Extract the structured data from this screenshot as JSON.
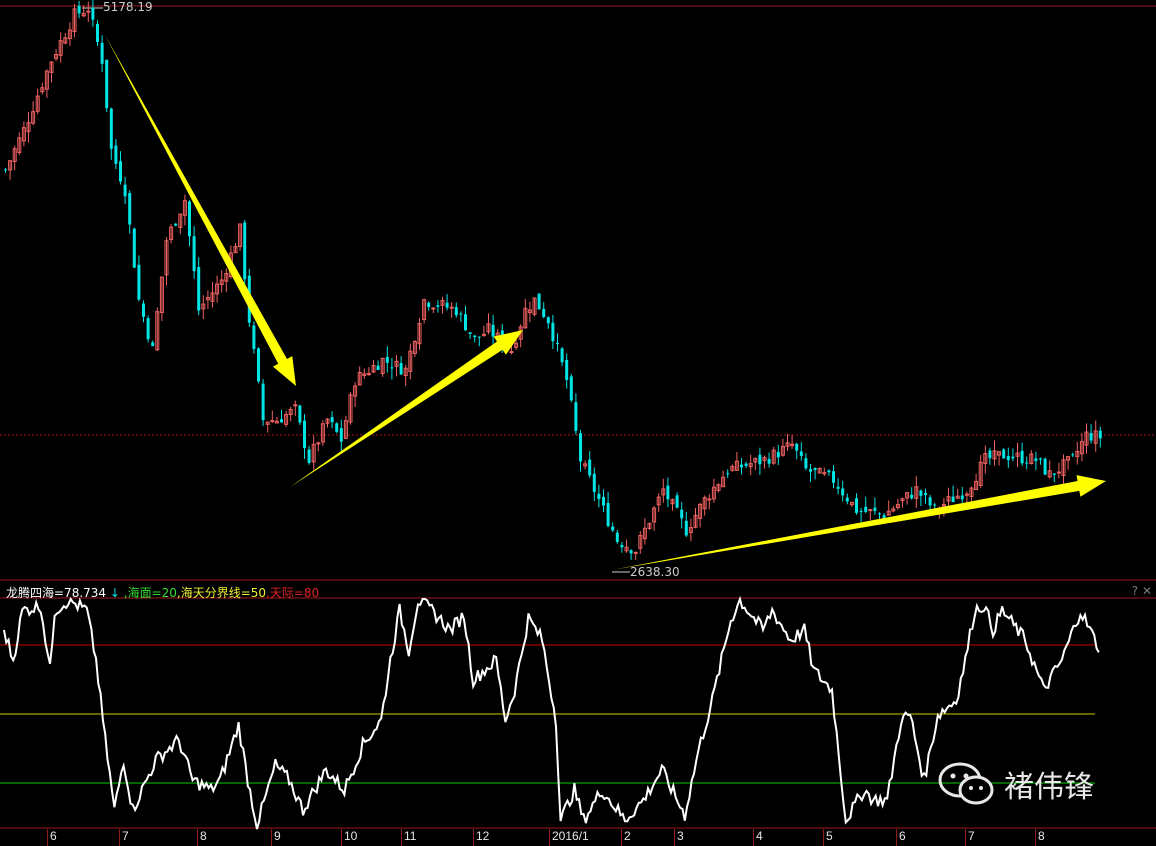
{
  "price_panel": {
    "high_label": "5178.19",
    "low_label": "2638.30",
    "high_price": 5178.19,
    "low_price": 2638.3,
    "last_price_line": 3255,
    "colors": {
      "up": "#f06262",
      "down": "#00e5e5",
      "arrow": "#ffff00",
      "grid": "#a01818"
    },
    "close_knots": [
      [
        0,
        4449
      ],
      [
        4,
        4629
      ],
      [
        10,
        4944
      ],
      [
        15,
        5147
      ],
      [
        18,
        5178
      ],
      [
        21,
        4944
      ],
      [
        23,
        4539
      ],
      [
        26,
        4359
      ],
      [
        29,
        3863
      ],
      [
        32,
        3638
      ],
      [
        35,
        4133
      ],
      [
        39,
        4314
      ],
      [
        42,
        3818
      ],
      [
        47,
        3953
      ],
      [
        51,
        4178
      ],
      [
        53,
        3773
      ],
      [
        56,
        3323
      ],
      [
        59,
        3323
      ],
      [
        63,
        3368
      ],
      [
        66,
        3143
      ],
      [
        70,
        3323
      ],
      [
        73,
        3233
      ],
      [
        76,
        3503
      ],
      [
        82,
        3593
      ],
      [
        87,
        3548
      ],
      [
        91,
        3863
      ],
      [
        98,
        3818
      ],
      [
        102,
        3683
      ],
      [
        105,
        3728
      ],
      [
        110,
        3638
      ],
      [
        113,
        3818
      ],
      [
        115,
        3863
      ],
      [
        118,
        3773
      ],
      [
        122,
        3503
      ],
      [
        125,
        3143
      ],
      [
        128,
        3008
      ],
      [
        133,
        2782
      ],
      [
        137,
        2737
      ],
      [
        143,
        3008
      ],
      [
        148,
        2827
      ],
      [
        152,
        2963
      ],
      [
        157,
        3098
      ],
      [
        161,
        3120
      ],
      [
        165,
        3143
      ],
      [
        171,
        3210
      ],
      [
        174,
        3098
      ],
      [
        180,
        3053
      ],
      [
        185,
        2918
      ],
      [
        191,
        2895
      ],
      [
        198,
        3008
      ],
      [
        202,
        2918
      ],
      [
        209,
        3008
      ],
      [
        213,
        3143
      ],
      [
        217,
        3165
      ],
      [
        224,
        3143
      ],
      [
        227,
        3075
      ],
      [
        232,
        3143
      ],
      [
        235,
        3255
      ],
      [
        238,
        3246
      ]
    ]
  },
  "indicator": {
    "name": "龙腾四海=78.734",
    "arrow": "↓",
    "sea_level": ",海面=20",
    "divider": ",海天分界线=50",
    "sky": ",天际=80",
    "levels": {
      "sea": 20,
      "divider": 50,
      "sky": 80
    },
    "colors": {
      "line": "#ffffff",
      "sea": "#00cc00",
      "divider": "#cccc00",
      "sky": "#cc0000"
    },
    "help": "?",
    "close": "✕",
    "knots": [
      [
        0,
        86.5
      ],
      [
        2,
        73.5
      ],
      [
        4,
        95
      ],
      [
        8,
        97
      ],
      [
        10,
        69
      ],
      [
        11,
        95
      ],
      [
        14,
        99.5
      ],
      [
        18,
        95
      ],
      [
        20,
        73.5
      ],
      [
        22,
        38.7
      ],
      [
        24,
        8.3
      ],
      [
        26,
        30
      ],
      [
        28,
        8.3
      ],
      [
        33,
        30
      ],
      [
        38,
        38.7
      ],
      [
        41,
        21.3
      ],
      [
        45,
        17
      ],
      [
        47,
        21.3
      ],
      [
        51,
        45.2
      ],
      [
        53,
        21.3
      ],
      [
        55,
        1.7
      ],
      [
        59,
        27.8
      ],
      [
        62,
        21.3
      ],
      [
        65,
        8.3
      ],
      [
        70,
        25.7
      ],
      [
        74,
        17
      ],
      [
        78,
        36.5
      ],
      [
        82,
        47.4
      ],
      [
        84,
        73.5
      ],
      [
        86,
        95
      ],
      [
        88,
        77.8
      ],
      [
        90,
        99.5
      ],
      [
        93,
        95
      ],
      [
        97,
        86.5
      ],
      [
        100,
        93
      ],
      [
        102,
        64.8
      ],
      [
        107,
        73.5
      ],
      [
        109,
        47.4
      ],
      [
        111,
        60.4
      ],
      [
        114,
        91.7
      ],
      [
        117,
        82.2
      ],
      [
        120,
        47.4
      ],
      [
        121,
        3.9
      ],
      [
        124,
        17
      ],
      [
        126,
        3.9
      ],
      [
        130,
        17
      ],
      [
        135,
        3.9
      ],
      [
        139,
        12.6
      ],
      [
        143,
        25.7
      ],
      [
        148,
        6.1
      ],
      [
        151,
        34.3
      ],
      [
        154,
        56.1
      ],
      [
        158,
        90.9
      ],
      [
        160,
        99.5
      ],
      [
        165,
        86.5
      ],
      [
        167,
        95
      ],
      [
        171,
        82.2
      ],
      [
        174,
        86.5
      ],
      [
        176,
        69.1
      ],
      [
        180,
        60.4
      ],
      [
        183,
        3.9
      ],
      [
        187,
        17
      ],
      [
        189,
        12.6
      ],
      [
        192,
        12.6
      ],
      [
        195,
        47.4
      ],
      [
        197,
        49.6
      ],
      [
        200,
        21.3
      ],
      [
        203,
        49.6
      ],
      [
        207,
        56.1
      ],
      [
        209,
        73.5
      ],
      [
        211,
        95
      ],
      [
        213,
        97.4
      ],
      [
        215,
        86.5
      ],
      [
        217,
        95
      ],
      [
        222,
        82.2
      ],
      [
        226,
        60.4
      ],
      [
        230,
        73.5
      ],
      [
        234,
        95
      ],
      [
        238,
        78.7
      ]
    ]
  },
  "x_axis": {
    "labels": [
      "6",
      "7",
      "8",
      "9",
      "10",
      "11",
      "12",
      "2016/1",
      "2",
      "3",
      "4",
      "5",
      "6",
      "7",
      "8"
    ]
  },
  "watermark": {
    "text": "褚伟锋",
    "icon": "wechat-icon"
  }
}
